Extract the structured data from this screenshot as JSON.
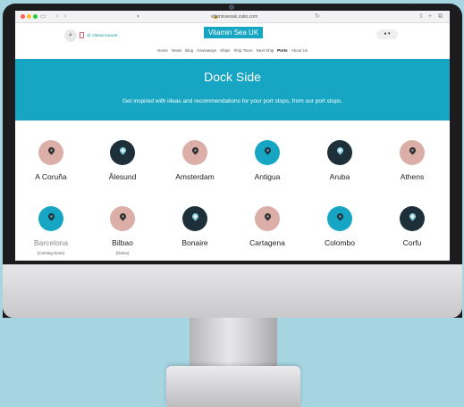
{
  "browser": {
    "url": "vitaminseauk.zabo.com",
    "traffic_lights": [
      "#ff5f57",
      "#febc2e",
      "#28c840"
    ]
  },
  "header": {
    "search_icon": "search-icon",
    "social_handle": "@ VitaminSeaUK",
    "brand": "Vitamin Sea UK",
    "account_icon": "user-icon"
  },
  "nav": {
    "items": [
      "Home",
      "News",
      "Blog",
      "Giveaways",
      "Ships",
      "Ship Tours",
      "Next Ship",
      "Ports",
      "About Us"
    ],
    "active": "Ports"
  },
  "hero": {
    "title": "Dock Side",
    "subtitle": "Get inspired with ideas and recommendations for your port stops, from our port stops.",
    "color": "#16a6c3"
  },
  "colors": {
    "pink": "#dcaea8",
    "teal": "#16a6c3",
    "dark": "#1d2f38"
  },
  "ports": [
    {
      "name": "A Coruña",
      "color": "pink",
      "note": ""
    },
    {
      "name": "Ålesund",
      "color": "dark",
      "note": ""
    },
    {
      "name": "Amsterdam",
      "color": "pink",
      "note": ""
    },
    {
      "name": "Antigua",
      "color": "teal",
      "note": ""
    },
    {
      "name": "Aruba",
      "color": "dark",
      "note": ""
    },
    {
      "name": "Athens",
      "color": "pink",
      "note": ""
    },
    {
      "name": "Barcelona",
      "color": "teal",
      "note": "(Coming Soon)"
    },
    {
      "name": "Bilbao",
      "color": "pink",
      "note": "(Getxo)"
    },
    {
      "name": "Bonaire",
      "color": "dark",
      "note": ""
    },
    {
      "name": "Cartagena",
      "color": "pink",
      "note": ""
    },
    {
      "name": "Colombo",
      "color": "teal",
      "note": ""
    },
    {
      "name": "Corfu",
      "color": "dark",
      "note": ""
    }
  ]
}
